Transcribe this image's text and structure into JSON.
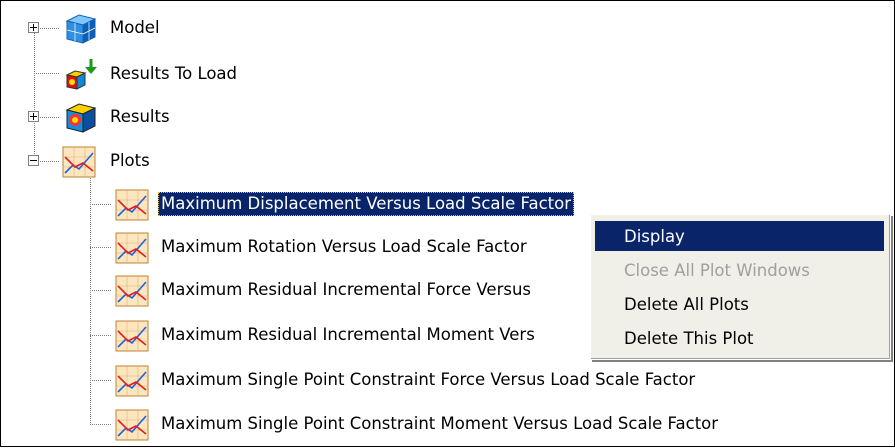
{
  "tree": {
    "nodes": [
      {
        "label": "Model",
        "icon": "model-cube-icon",
        "expander": "+"
      },
      {
        "label": "Results To Load",
        "icon": "results-to-load-icon",
        "expander": ""
      },
      {
        "label": "Results",
        "icon": "results-cube-icon",
        "expander": "+"
      },
      {
        "label": "Plots",
        "icon": "plot-icon",
        "expander": "-"
      }
    ],
    "plots": [
      {
        "label": "Maximum Displacement Versus Load Scale Factor"
      },
      {
        "label": "Maximum Rotation Versus Load Scale Factor"
      },
      {
        "label": "Maximum Residual Incremental Force Versus"
      },
      {
        "label": "Maximum Residual Incremental Moment Vers"
      },
      {
        "label": "Maximum Single Point Constraint Force Versus Load Scale Factor"
      },
      {
        "label": "Maximum Single Point Constraint Moment Versus Load Scale Factor"
      }
    ]
  },
  "context_menu": {
    "items": [
      {
        "label": "Display",
        "state": "highlighted"
      },
      {
        "label": "Close All Plot Windows",
        "state": "disabled"
      },
      {
        "label": "Delete All Plots",
        "state": "enabled"
      },
      {
        "label": "Delete This Plot",
        "state": "enabled"
      }
    ]
  },
  "colors": {
    "selection": "#0a246a",
    "menu_bg": "#f0efe8",
    "disabled_text": "#a0a0a0"
  }
}
